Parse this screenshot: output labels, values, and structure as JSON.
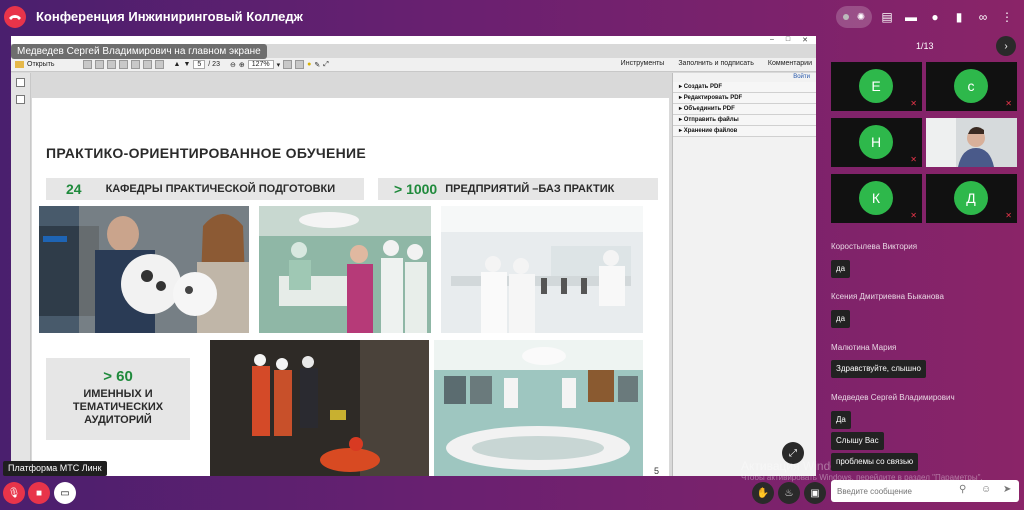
{
  "header": {
    "title": "Конференция Инжиниринговый Колледж"
  },
  "icons": {
    "end_call": "phone-hangup-icon",
    "top": [
      "sound-indicator-icon",
      "noise-icon",
      "document-list-icon",
      "chat-icon",
      "participants-icon",
      "file-icon",
      "link-icon",
      "more-icon"
    ]
  },
  "presenter_label": "Медведев Сергей Владимирович на главном экране",
  "pdf_viewer": {
    "open_label": "Открыть",
    "page_current": "5",
    "page_total": "/ 23",
    "zoom": "127%",
    "right_tabs": [
      "Инструменты",
      "Заполнить и подписать",
      "Комментарии"
    ],
    "login_link": "Войти",
    "tools": [
      "Создать PDF",
      "Редактировать PDF",
      "Объединить PDF",
      "Отправить файлы",
      "Хранение файлов"
    ]
  },
  "slide": {
    "title": "ПРАКТИКО-ОРИЕНТИРОВАННОЕ ОБУЧЕНИЕ",
    "stat1_num": "24",
    "stat1_text": "КАФЕДРЫ ПРАКТИЧЕСКОЙ ПОДГОТОВКИ",
    "stat2_num": "> 1000",
    "stat2_text": "ПРЕДПРИЯТИЙ –БАЗ ПРАКТИК",
    "stat3_num": "> 60",
    "stat3_text": "ИМЕННЫХ И\nТЕМАТИЧЕСКИХ\nАУДИТОРИЙ",
    "page_number": "5"
  },
  "tooltip": "Платформа МТС Линк",
  "watermark": {
    "line1": "Активация Windows",
    "line2": "Чтобы активировать Windows, перейдите в раздел \"Параметры\"."
  },
  "sidebar": {
    "page_counter": "1/13",
    "participants": [
      {
        "initial": "Е"
      },
      {
        "initial": "с"
      },
      {
        "initial": "Н"
      },
      {
        "initial": ""
      },
      {
        "initial": "К"
      },
      {
        "initial": "Д"
      }
    ],
    "chat": [
      {
        "name": "Коростылева Виктория",
        "messages": [
          "да"
        ]
      },
      {
        "name": "Ксения Дмитриевна Быканова",
        "messages": [
          "да"
        ]
      },
      {
        "name": "Малютина Мария",
        "messages": [
          "Здравствуйте, слышно"
        ]
      },
      {
        "name": "Медведев Сергей Владимирович",
        "messages": [
          "Да",
          "Слышу Вас",
          "проблемы со связью"
        ]
      }
    ],
    "input_placeholder": "Введите сообщение"
  }
}
